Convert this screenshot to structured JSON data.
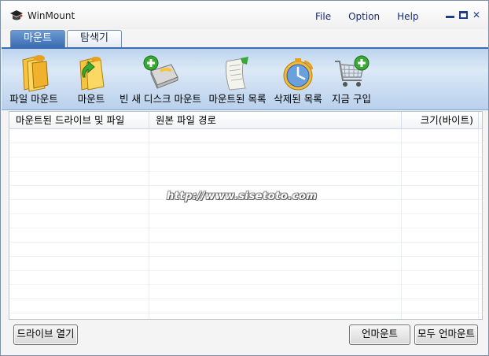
{
  "window": {
    "title": "WinMount",
    "menu": [
      "File",
      "Option",
      "Help"
    ]
  },
  "tabs": [
    {
      "label": "마운트",
      "active": true
    },
    {
      "label": "탐색기",
      "active": false
    }
  ],
  "toolbar": {
    "items": [
      {
        "label": "파일 마운트",
        "icon": "folder-disk-icon"
      },
      {
        "label": "마운트",
        "icon": "folder-arrow-icon"
      },
      {
        "label": "빈 새 디스크 마운트",
        "icon": "new-disk-icon"
      },
      {
        "label": "마운트된 목록",
        "icon": "document-list-icon"
      },
      {
        "label": "삭제된 목록",
        "icon": "clock-icon"
      },
      {
        "label": "지금 구입",
        "icon": "shopping-cart-icon"
      }
    ]
  },
  "table": {
    "columns": [
      "마운트된 드라이브 및 파일",
      "원본 파일 경로",
      "크기(바이트)"
    ],
    "rows": [],
    "watermark": "http://www.sisetoto.com"
  },
  "buttons": {
    "open_drive": "드라이브 열기",
    "unmount": "언마운트",
    "unmount_all": "모두 언마운트"
  },
  "colors": {
    "accent": "#3b6db2",
    "toolbar_bg": "#dce9f7"
  }
}
